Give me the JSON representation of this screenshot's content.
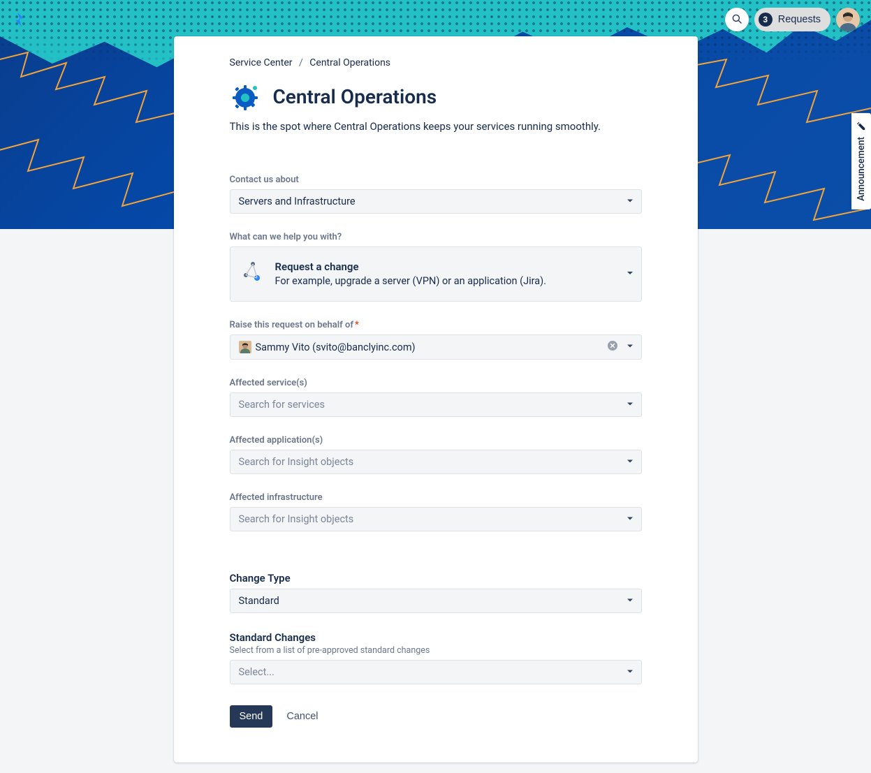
{
  "header": {
    "requests_count": "3",
    "requests_label": "Requests"
  },
  "announcement_tab": "Announcement",
  "breadcrumb": {
    "root": "Service Center",
    "current": "Central Operations"
  },
  "page": {
    "title": "Central Operations",
    "description": "This is the spot where Central Operations keeps your services running smoothly."
  },
  "form": {
    "contact_about": {
      "label": "Contact us about",
      "value": "Servers and Infrastructure"
    },
    "help_with": {
      "label": "What can we help you with?",
      "title": "Request a change",
      "desc": "For example, upgrade a server (VPN) or an application (Jira)."
    },
    "on_behalf": {
      "label": "Raise this request on behalf of",
      "required": true,
      "value": "Sammy Vito (svito@banclyinc.com)"
    },
    "affected_services": {
      "label": "Affected service(s)",
      "placeholder": "Search for services"
    },
    "affected_applications": {
      "label": "Affected application(s)",
      "placeholder": "Search for Insight objects"
    },
    "affected_infrastructure": {
      "label": "Affected infrastructure",
      "placeholder": "Search for Insight objects"
    },
    "change_type": {
      "label": "Change Type",
      "value": "Standard"
    },
    "standard_changes": {
      "label": "Standard Changes",
      "hint": "Select from a list of pre-approved standard changes",
      "placeholder": "Select..."
    },
    "send": "Send",
    "cancel": "Cancel"
  }
}
